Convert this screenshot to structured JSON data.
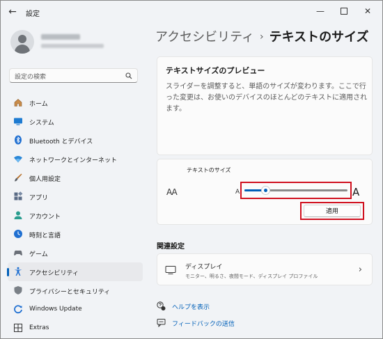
{
  "window": {
    "title": "設定",
    "back_glyph": "←",
    "minimize_glyph": "—",
    "close_glyph": "✕"
  },
  "search": {
    "placeholder": "設定の検索"
  },
  "sidebar": {
    "items": [
      {
        "label": "ホーム",
        "icon": "home-icon"
      },
      {
        "label": "システム",
        "icon": "system-icon"
      },
      {
        "label": "Bluetooth とデバイス",
        "icon": "bluetooth-icon"
      },
      {
        "label": "ネットワークとインターネット",
        "icon": "wifi-icon"
      },
      {
        "label": "個人用設定",
        "icon": "brush-icon"
      },
      {
        "label": "アプリ",
        "icon": "apps-icon"
      },
      {
        "label": "アカウント",
        "icon": "account-icon"
      },
      {
        "label": "時刻と言語",
        "icon": "time-language-icon"
      },
      {
        "label": "ゲーム",
        "icon": "gamepad-icon"
      },
      {
        "label": "アクセシビリティ",
        "icon": "accessibility-icon",
        "selected": true
      },
      {
        "label": "プライバシーとセキュリティ",
        "icon": "shield-icon"
      },
      {
        "label": "Windows Update",
        "icon": "windows-update-icon"
      },
      {
        "label": "Extras",
        "icon": "extras-icon"
      }
    ]
  },
  "breadcrumb": {
    "parent": "アクセシビリティ",
    "separator": "›",
    "current": "テキストのサイズ"
  },
  "preview": {
    "title": "テキストサイズのプレビュー",
    "text": "スライダーを調整すると、単語のサイズが変わります。ここで行った変更は、お使いのデバイスのほとんどのテキストに適用されます。"
  },
  "text_size": {
    "label": "テキストのサイズ",
    "icon_text": "AA",
    "small_a": "A",
    "large_a": "A",
    "slider_value_fraction": 0.2,
    "apply_label": "適用"
  },
  "related": {
    "heading": "関連設定",
    "display_title": "ディスプレイ",
    "display_subtitle": "モニター、明るさ、夜間モード、ディスプレイ プロファイル"
  },
  "links": {
    "help": "ヘルプを表示",
    "feedback": "フィードバックの送信"
  },
  "colors": {
    "accent": "#005fb8",
    "highlight": "#d0101f"
  }
}
